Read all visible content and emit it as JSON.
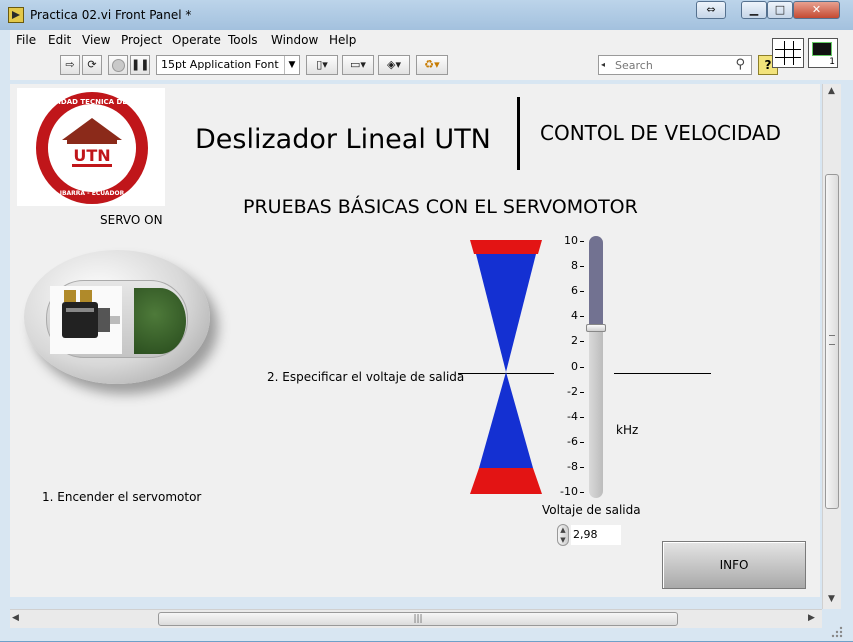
{
  "window": {
    "title": "Practica 02.vi Front Panel *"
  },
  "menu": [
    "File",
    "Edit",
    "View",
    "Project",
    "Operate",
    "Tools",
    "Window",
    "Help"
  ],
  "toolbar": {
    "font_label": "15pt Application Font",
    "search_placeholder": "Search",
    "help_label": "?"
  },
  "vi_icon": {
    "number": "1"
  },
  "panel": {
    "title": "Deslizador Lineal UTN",
    "subtitle": "CONTOL DE VELOCIDAD",
    "section_title": "PRUEBAS BÁSICAS CON EL SERVOMOTOR",
    "servo_label": "SERVO ON",
    "step1": "1. Encender el servomotor",
    "step2": "2. Especificar el voltaje de salida",
    "unit": "kHz",
    "slider_label": "Voltaje de salida",
    "slider_value": "2,98",
    "slider_level": 2.98,
    "slider_range": [
      -10,
      10
    ],
    "scale_ticks": [
      "10",
      "8",
      "6",
      "4",
      "2",
      "0",
      "-2",
      "-4",
      "-6",
      "-8",
      "-10"
    ],
    "info_label": "INFO"
  },
  "logo": {
    "text_top": "UNIVERSIDAD TECNICA DEL NORTE",
    "text_mid": "UTN",
    "text_bottom": "IBARRA - ECUADOR"
  },
  "colors": {
    "accent_red": "#e31414",
    "accent_blue": "#1430d2",
    "led_green": "#3a612a",
    "slider_fill": "#727291"
  }
}
